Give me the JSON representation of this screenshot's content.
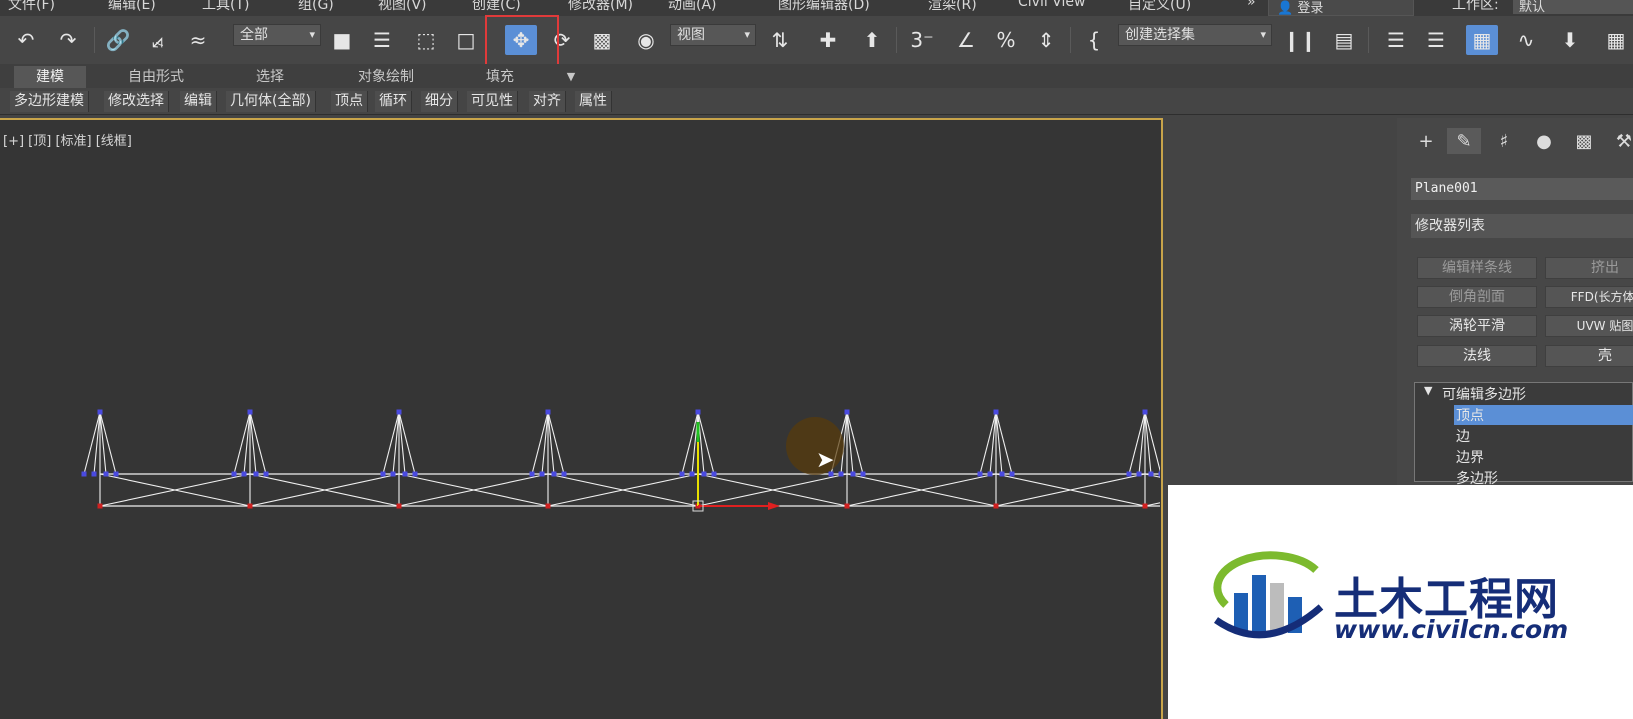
{
  "menu": {
    "items": [
      "文件(F)",
      "编辑(E)",
      "工具(T)",
      "组(G)",
      "视图(V)",
      "创建(C)",
      "修改器(M)",
      "动画(A)",
      "图形编辑器(D)",
      "渲染(R)",
      "Civil View",
      "自定义(U)"
    ],
    "more": "»",
    "login_label": "登录",
    "workspace_label": "工作区:",
    "workspace_value": "默认"
  },
  "toolbar": {
    "selection_filter": "全部",
    "ref_coord": "视图",
    "selection_set": "创建选择集",
    "dd_arrow": "▾"
  },
  "ribbon": {
    "tabs": [
      "建模",
      "自由形式",
      "选择",
      "对象绘制",
      "填充"
    ],
    "active_tab": 0,
    "buttons": [
      "多边形建模",
      "修改选择",
      "编辑",
      "几何体(全部)",
      "顶点",
      "循环",
      "细分",
      "可见性",
      "对齐",
      "属性"
    ]
  },
  "viewport": {
    "label": "[+] [顶] [标准] [线框]"
  },
  "panel": {
    "object_name": "Plane001",
    "modifier_list": "修改器列表",
    "modifier_buttons": [
      {
        "label": "编辑样条线",
        "enabled": false
      },
      {
        "label": "挤出",
        "enabled": false
      },
      {
        "label": "倒角剖面",
        "enabled": false
      },
      {
        "label": "FFD(长方体)",
        "enabled": true
      },
      {
        "label": "涡轮平滑",
        "enabled": true
      },
      {
        "label": "UVW 贴图",
        "enabled": true
      },
      {
        "label": "法线",
        "enabled": true
      },
      {
        "label": "壳",
        "enabled": true
      }
    ],
    "stack_root": "可编辑多边形",
    "stack_items": [
      "顶点",
      "边",
      "边界",
      "多边形"
    ],
    "stack_selected": 0
  },
  "watermark": {
    "title": "土木工程网",
    "url": "www.civilcn.com"
  },
  "colors": {
    "accent_blue": "#5b8fd6",
    "viewport_border": "#c8a44a",
    "highlight_red": "#e03a3a",
    "vertex_blue": "#4a4ae0",
    "vertex_red": "#d02020",
    "logo_blue": "#152d78"
  }
}
